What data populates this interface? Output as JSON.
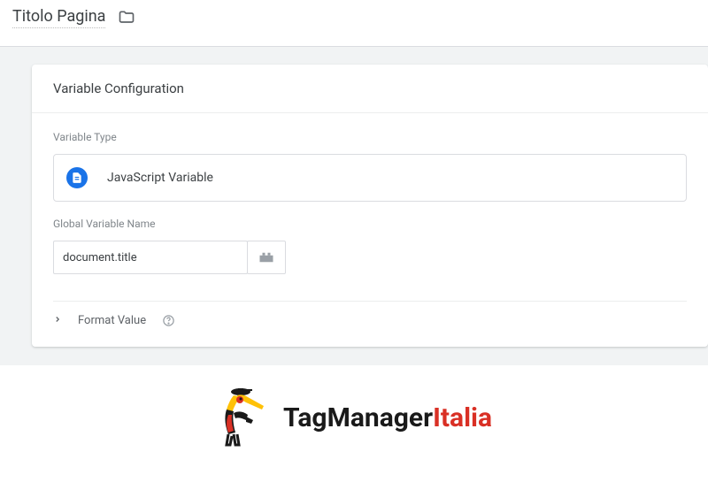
{
  "page": {
    "title": "Titolo Pagina"
  },
  "card": {
    "header": "Variable Configuration",
    "type_label": "Variable Type",
    "type_name": "JavaScript Variable",
    "varname_label": "Global Variable Name",
    "varname_value": "document.title",
    "format_label": "Format Value"
  },
  "logo": {
    "part1": "TagManager",
    "part2": "Italia"
  }
}
